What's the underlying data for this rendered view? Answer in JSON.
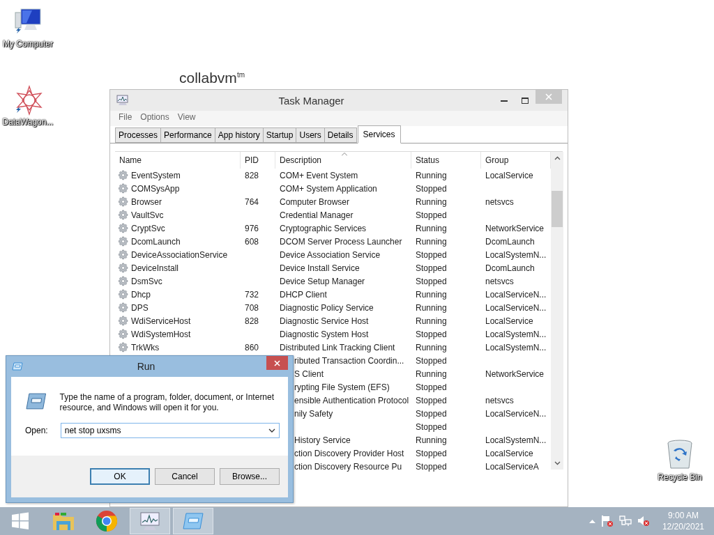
{
  "desktop": {
    "wallpaper_logo": "collabvm$^{tm}$",
    "icons_left": [
      {
        "kind": "computer",
        "label": "My Computer"
      },
      {
        "kind": "star",
        "label": "DataWagon..."
      }
    ],
    "icons_right": [
      {
        "kind": "recycle",
        "label": "Recycle Bin"
      }
    ]
  },
  "task_manager": {
    "title": "Task Manager",
    "menu": [
      "File",
      "Options",
      "View"
    ],
    "tabs": [
      {
        "label": "Processes",
        "selected": false
      },
      {
        "label": "Performance",
        "selected": false
      },
      {
        "label": "App history",
        "selected": false
      },
      {
        "label": "Startup",
        "selected": false
      },
      {
        "label": "Users",
        "selected": false
      },
      {
        "label": "Details",
        "selected": false
      },
      {
        "label": "Services",
        "selected": true
      }
    ],
    "columns": [
      "Name",
      "PID",
      "Description",
      "Status",
      "Group"
    ],
    "rows": [
      {
        "name": "EventSystem",
        "pid": "828",
        "description": "COM+ Event System",
        "status": "Running",
        "group": "LocalService"
      },
      {
        "name": "COMSysApp",
        "description": "COM+ System Application",
        "status": "Stopped"
      },
      {
        "name": "Browser",
        "pid": "764",
        "description": "Computer Browser",
        "status": "Running",
        "group": "netsvcs"
      },
      {
        "name": "VaultSvc",
        "description": "Credential Manager",
        "status": "Stopped"
      },
      {
        "name": "CryptSvc",
        "pid": "976",
        "description": "Cryptographic Services",
        "status": "Running",
        "group": "NetworkService"
      },
      {
        "name": "DcomLaunch",
        "pid": "608",
        "description": "DCOM Server Process Launcher",
        "status": "Running",
        "group": "DcomLaunch"
      },
      {
        "name": "DeviceAssociationService",
        "description": "Device Association Service",
        "status": "Stopped",
        "group": "LocalSystemN..."
      },
      {
        "name": "DeviceInstall",
        "description": "Device Install Service",
        "status": "Stopped",
        "group": "DcomLaunch"
      },
      {
        "name": "DsmSvc",
        "description": "Device Setup Manager",
        "status": "Stopped",
        "group": "netsvcs"
      },
      {
        "name": "Dhcp",
        "pid": "732",
        "description": "DHCP Client",
        "status": "Running",
        "group": "LocalServiceN..."
      },
      {
        "name": "DPS",
        "pid": "708",
        "description": "Diagnostic Policy Service",
        "status": "Running",
        "group": "LocalServiceN..."
      },
      {
        "name": "WdiServiceHost",
        "pid": "828",
        "description": "Diagnostic Service Host",
        "status": "Running",
        "group": "LocalService"
      },
      {
        "name": "WdiSystemHost",
        "description": "Diagnostic System Host",
        "status": "Stopped",
        "group": "LocalSystemN..."
      },
      {
        "name": "TrkWks",
        "pid": "860",
        "description": "Distributed Link Tracking Client",
        "status": "Running",
        "group": "LocalSystemN..."
      },
      {
        "description": "ributed Transaction Coordin...",
        "status": "Stopped"
      },
      {
        "description": "S Client",
        "status": "Running",
        "group": "NetworkService"
      },
      {
        "description": "rypting File System (EFS)",
        "status": "Stopped"
      },
      {
        "description": "ensible Authentication Protocol",
        "status": "Stopped",
        "group": "netsvcs"
      },
      {
        "description": "nily Safety",
        "status": "Stopped",
        "group": "LocalServiceN..."
      },
      {
        "status": "Stopped"
      },
      {
        "description": "History Service",
        "status": "Running",
        "group": "LocalSystemN..."
      },
      {
        "description": "ction Discovery Provider Host",
        "status": "Stopped",
        "group": "LocalService"
      },
      {
        "description": "ction Discovery Resource Pu",
        "status": "Stopped",
        "group": "LocalServiceA"
      }
    ]
  },
  "run_dialog": {
    "title": "Run",
    "message": "Type the name of a program, folder, document, or Internet resource, and Windows will open it for you.",
    "open_label": "Open:",
    "value": "net stop uxsms",
    "buttons": [
      {
        "label": "OK",
        "default": true
      },
      {
        "label": "Cancel",
        "default": false
      },
      {
        "label": "Browse...",
        "default": false
      }
    ]
  },
  "taskbar": {
    "apps": [
      {
        "kind": "start",
        "active": false
      },
      {
        "kind": "folder",
        "active": false
      },
      {
        "kind": "browser",
        "active": false
      },
      {
        "kind": "taskmgr",
        "active": true
      },
      {
        "kind": "run",
        "active": true
      }
    ],
    "clock": {
      "time": "9:00 AM",
      "date": "12/20/2021"
    }
  }
}
